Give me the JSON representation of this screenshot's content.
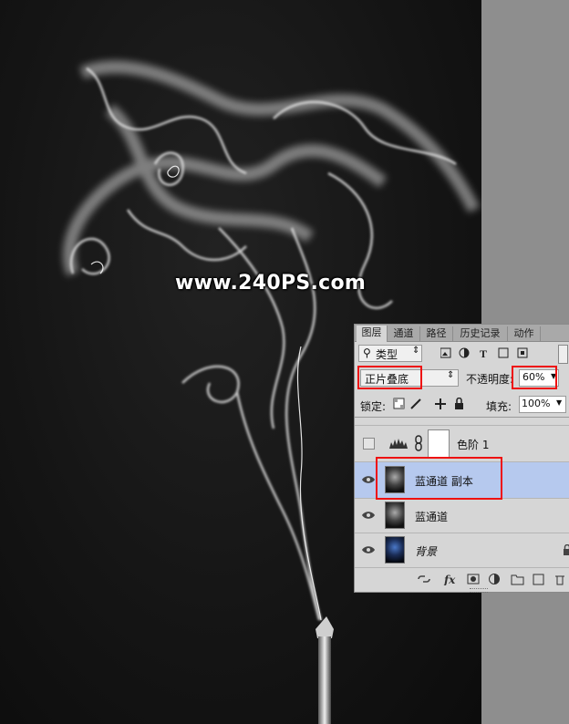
{
  "watermark": "www.240PS.com",
  "panel": {
    "tabs": [
      {
        "label": "图层",
        "active": true
      },
      {
        "label": "通道",
        "active": false
      },
      {
        "label": "路径",
        "active": false
      },
      {
        "label": "历史记录",
        "active": false
      },
      {
        "label": "动作",
        "active": false
      }
    ],
    "filter_kind": "类型",
    "blend_mode": "正片叠底",
    "opacity_label": "不透明度:",
    "opacity_value": "60%",
    "lock_label": "锁定:",
    "fill_label": "填充:",
    "fill_value": "100%",
    "layers": [
      {
        "name": "色阶 1",
        "visible": false,
        "selected": false,
        "type": "adjustment"
      },
      {
        "name": "蓝通道 副本",
        "visible": true,
        "selected": true,
        "type": "pixel"
      },
      {
        "name": "蓝通道",
        "visible": true,
        "selected": false,
        "type": "pixel"
      },
      {
        "name": "背景",
        "visible": true,
        "selected": false,
        "type": "background",
        "locked": true
      }
    ]
  },
  "colors": {
    "highlight": "#b6c9ee",
    "annotation": "#e11111"
  }
}
